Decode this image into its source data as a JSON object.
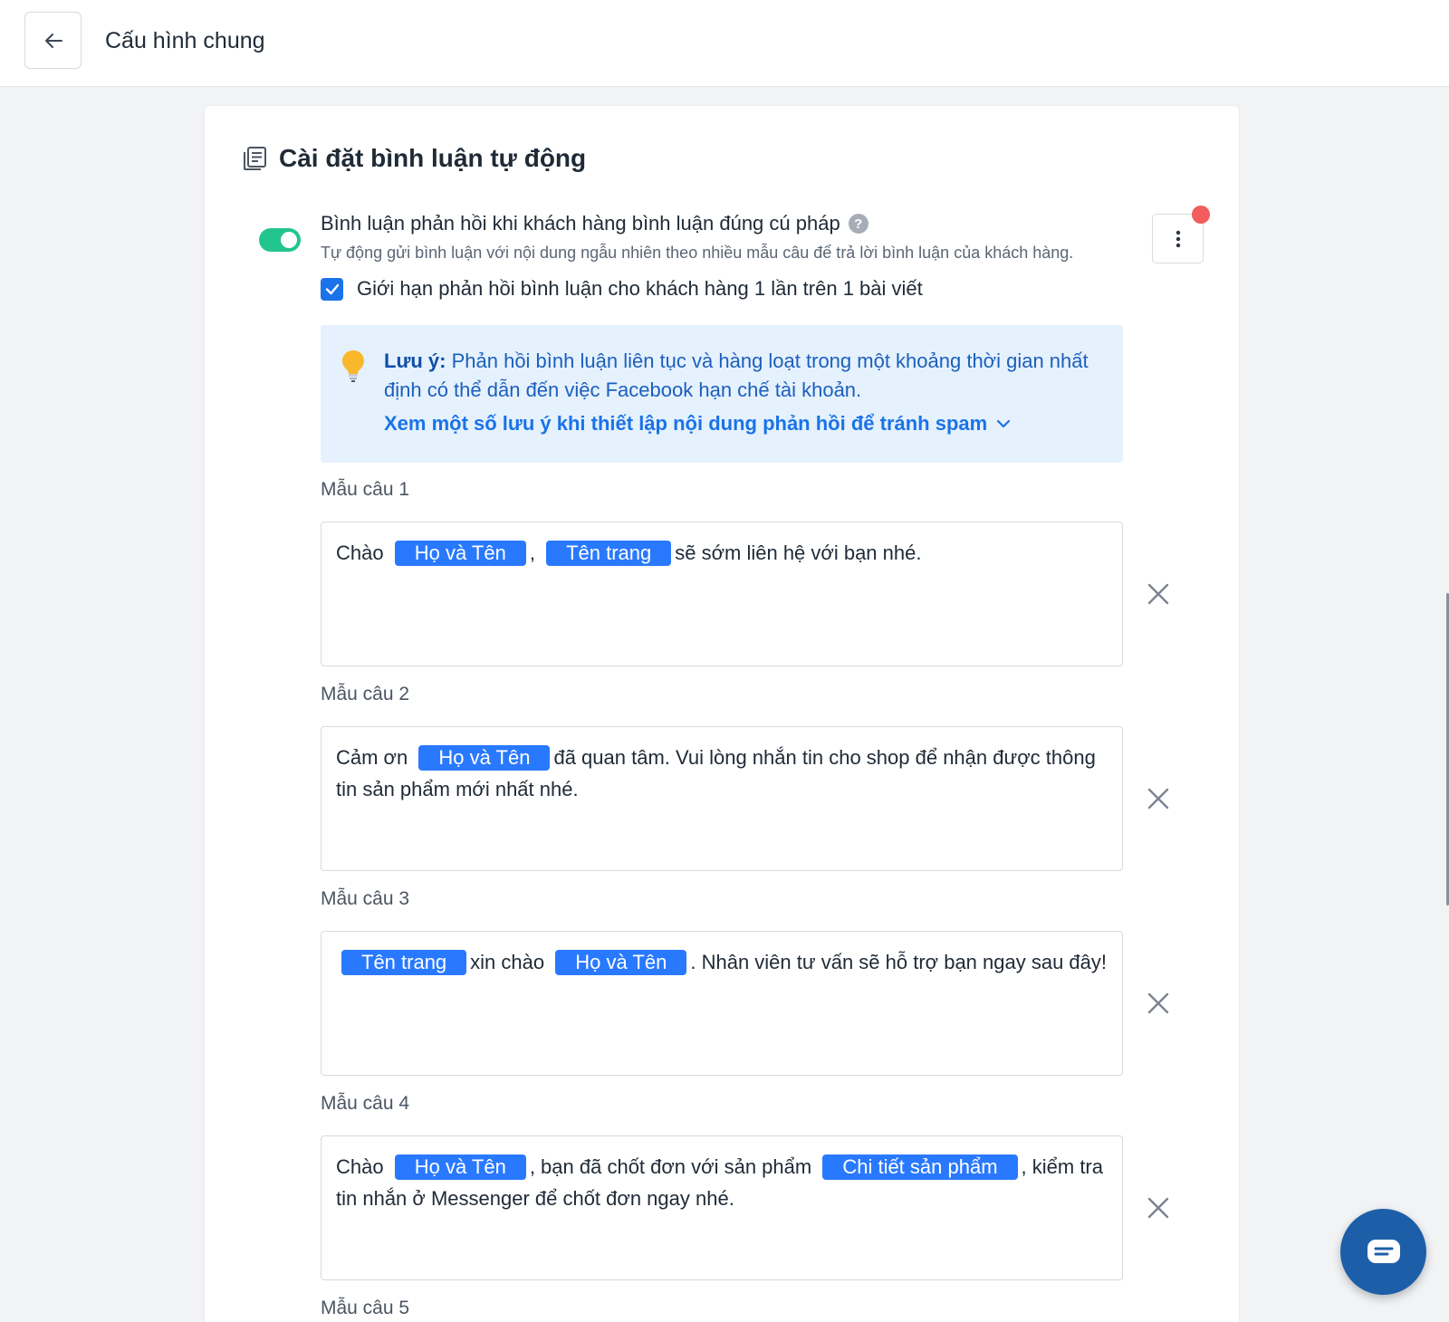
{
  "header": {
    "title": "Cấu hình chung"
  },
  "section": {
    "title": "Cài đặt bình luận tự động"
  },
  "option": {
    "title": "Bình luận phản hồi khi khách hàng bình luận đúng cú pháp",
    "description": "Tự động gửi bình luận với nội dung ngẫu nhiên theo nhiều mẫu câu để trả lời bình luận của khách hàng.",
    "enabled": true,
    "limit_label": "Giới hạn phản hồi bình luận cho khách hàng 1 lần trên 1 bài viết",
    "limit_checked": true
  },
  "note": {
    "label": "Lưu ý:",
    "text": " Phản hồi bình luận liên tục và hàng loạt trong một khoảng thời gian nhất định có thể dẫn đến việc Facebook hạn chế tài khoản.",
    "link": "Xem một số lưu ý khi thiết lập nội dung phản hồi để tránh spam"
  },
  "templates": [
    {
      "label": "Mẫu câu 1",
      "parts": [
        {
          "type": "text",
          "value": "Chào"
        },
        {
          "type": "chip",
          "value": "Họ và Tên"
        },
        {
          "type": "text",
          "value": ","
        },
        {
          "type": "chip",
          "value": "Tên trang"
        },
        {
          "type": "text",
          "value": "sẽ sớm liên hệ với bạn nhé."
        }
      ]
    },
    {
      "label": "Mẫu câu 2",
      "parts": [
        {
          "type": "text",
          "value": "Cảm ơn"
        },
        {
          "type": "chip",
          "value": "Họ và Tên"
        },
        {
          "type": "text",
          "value": "đã quan tâm. Vui lòng nhắn tin cho shop để nhận được thông tin sản phẩm mới nhất nhé."
        }
      ]
    },
    {
      "label": "Mẫu câu 3",
      "parts": [
        {
          "type": "chip",
          "value": "Tên trang"
        },
        {
          "type": "text",
          "value": "xin chào"
        },
        {
          "type": "chip",
          "value": "Họ và Tên"
        },
        {
          "type": "text",
          "value": ". Nhân viên tư vấn sẽ hỗ trợ bạn ngay sau đây!"
        }
      ]
    },
    {
      "label": "Mẫu câu 4",
      "parts": [
        {
          "type": "text",
          "value": "Chào"
        },
        {
          "type": "chip",
          "value": "Họ và Tên"
        },
        {
          "type": "text",
          "value": ", bạn đã chốt đơn với sản phẩm"
        },
        {
          "type": "chip",
          "value": "Chi tiết sản phẩm"
        },
        {
          "type": "text",
          "value": ", kiểm tra tin nhắn ở Messenger để chốt đơn ngay nhé."
        }
      ]
    },
    {
      "label": "Mẫu câu 5",
      "parts": []
    }
  ],
  "colors": {
    "toggle_on": "#22c58b",
    "chip": "#2979ff",
    "note_bg": "#e5f1fd",
    "notification_dot": "#f25c5c"
  }
}
